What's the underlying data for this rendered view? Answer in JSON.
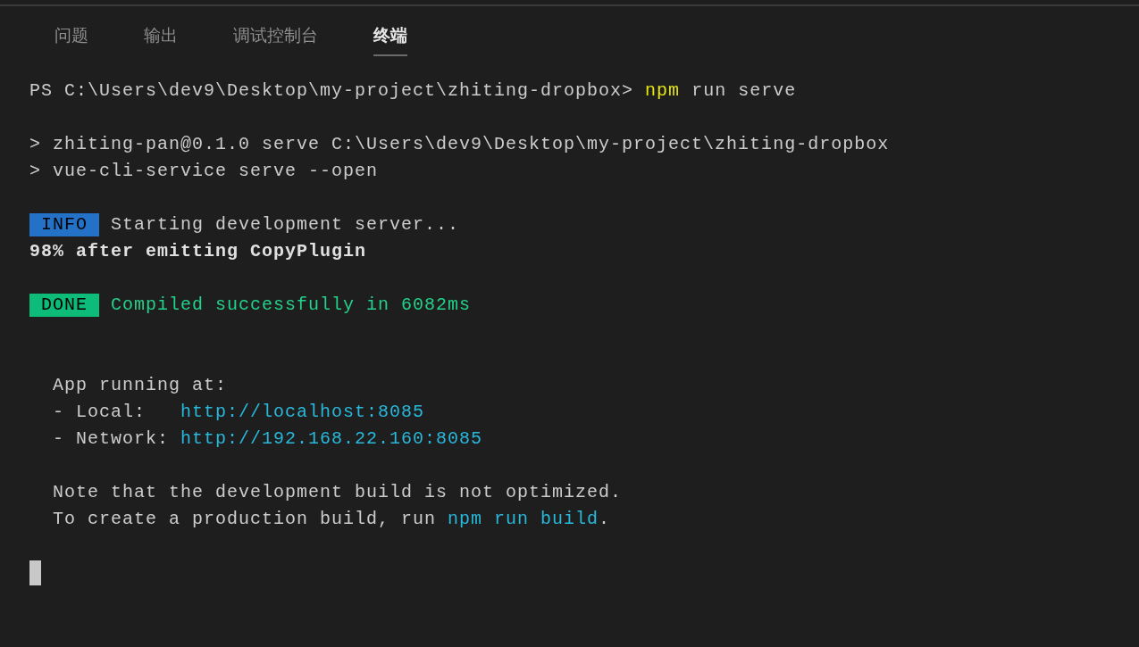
{
  "tabs": [
    {
      "label": "问题",
      "selected": false
    },
    {
      "label": "输出",
      "selected": false
    },
    {
      "label": "调试控制台",
      "selected": false
    },
    {
      "label": "终端",
      "selected": true
    }
  ],
  "terminal": {
    "lines": [
      {
        "kind": "text",
        "segments": [
          {
            "kind": "plain",
            "text": "PS C:\\Users\\dev9\\Desktop\\my-project\\zhiting-dropbox> "
          },
          {
            "kind": "command",
            "text": "npm"
          },
          {
            "kind": "plain",
            "text": " run serve"
          }
        ]
      },
      {
        "kind": "blank"
      },
      {
        "kind": "text",
        "segments": [
          {
            "kind": "plain",
            "text": "> zhiting-pan@0.1.0 serve C:\\Users\\dev9\\Desktop\\my-project\\zhiting-dropbox"
          }
        ]
      },
      {
        "kind": "text",
        "segments": [
          {
            "kind": "plain",
            "text": "> vue-cli-service serve --open"
          }
        ]
      },
      {
        "kind": "blank"
      },
      {
        "kind": "text",
        "segments": [
          {
            "kind": "badge",
            "text": "INFO",
            "color": "#2472c8"
          },
          {
            "kind": "plain",
            "text": " Starting development server..."
          }
        ]
      },
      {
        "kind": "text",
        "segments": [
          {
            "kind": "bold",
            "text": "98% after emitting CopyPlugin"
          }
        ]
      },
      {
        "kind": "blank"
      },
      {
        "kind": "text",
        "segments": [
          {
            "kind": "badge",
            "text": "DONE",
            "color": "#0dbc79"
          },
          {
            "kind": "success",
            "text": " Compiled successfully in 6082ms"
          }
        ]
      },
      {
        "kind": "blank"
      },
      {
        "kind": "blank"
      },
      {
        "kind": "text",
        "segments": [
          {
            "kind": "plain",
            "text": "  App running at:"
          }
        ]
      },
      {
        "kind": "text",
        "segments": [
          {
            "kind": "plain",
            "text": "  - Local:   "
          },
          {
            "kind": "link",
            "text": "http://localhost:8085"
          }
        ]
      },
      {
        "kind": "text",
        "segments": [
          {
            "kind": "plain",
            "text": "  - Network: "
          },
          {
            "kind": "link",
            "text": "http://192.168.22.160:8085"
          }
        ]
      },
      {
        "kind": "blank"
      },
      {
        "kind": "text",
        "segments": [
          {
            "kind": "plain",
            "text": "  Note that the development build is not optimized."
          }
        ]
      },
      {
        "kind": "text",
        "segments": [
          {
            "kind": "plain",
            "text": "  To create a production build, run "
          },
          {
            "kind": "link",
            "text": "npm run build"
          },
          {
            "kind": "plain",
            "text": "."
          }
        ]
      },
      {
        "kind": "blank"
      },
      {
        "kind": "cursor"
      }
    ]
  }
}
